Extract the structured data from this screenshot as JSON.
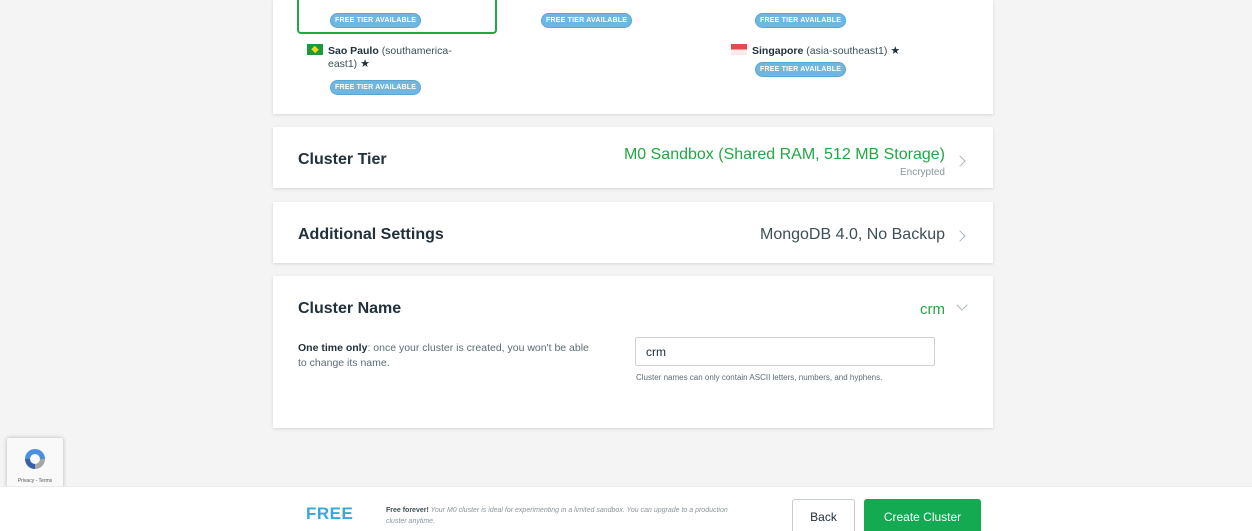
{
  "regions": {
    "badge_text": "FREE TIER AVAILABLE",
    "sao_paulo": {
      "name": "Sao Paulo",
      "code_line1": "(southamerica-",
      "code_line2": "east1)"
    },
    "singapore": {
      "name": "Singapore",
      "code": "(asia-southeast1)"
    }
  },
  "cluster_tier": {
    "title": "Cluster Tier",
    "value": "M0 Sandbox (Shared RAM, 512 MB Storage)",
    "sub": "Encrypted"
  },
  "additional_settings": {
    "title": "Additional Settings",
    "value": "MongoDB 4.0, No Backup"
  },
  "cluster_name": {
    "title": "Cluster Name",
    "value": "crm",
    "desc_bold": "One time only",
    "desc_rest": ": once your cluster is created, you won't be able to change its name.",
    "input_value": "crm",
    "hint": "Cluster names can only contain ASCII letters, numbers, and hyphens."
  },
  "recaptcha": {
    "links": "Privacy - Terms"
  },
  "footer": {
    "plan_label": "FREE",
    "desc_bold": "Free forever!",
    "desc_rest": " Your M0 cluster is ideal for experimenting in a limited sandbox. You can upgrade to a production cluster anytime.",
    "back_label": "Back",
    "create_label": "Create Cluster"
  },
  "colors": {
    "accent_green": "#13aa52",
    "badge_blue": "#6fb7e0",
    "free_blue": "#39a8d9"
  }
}
